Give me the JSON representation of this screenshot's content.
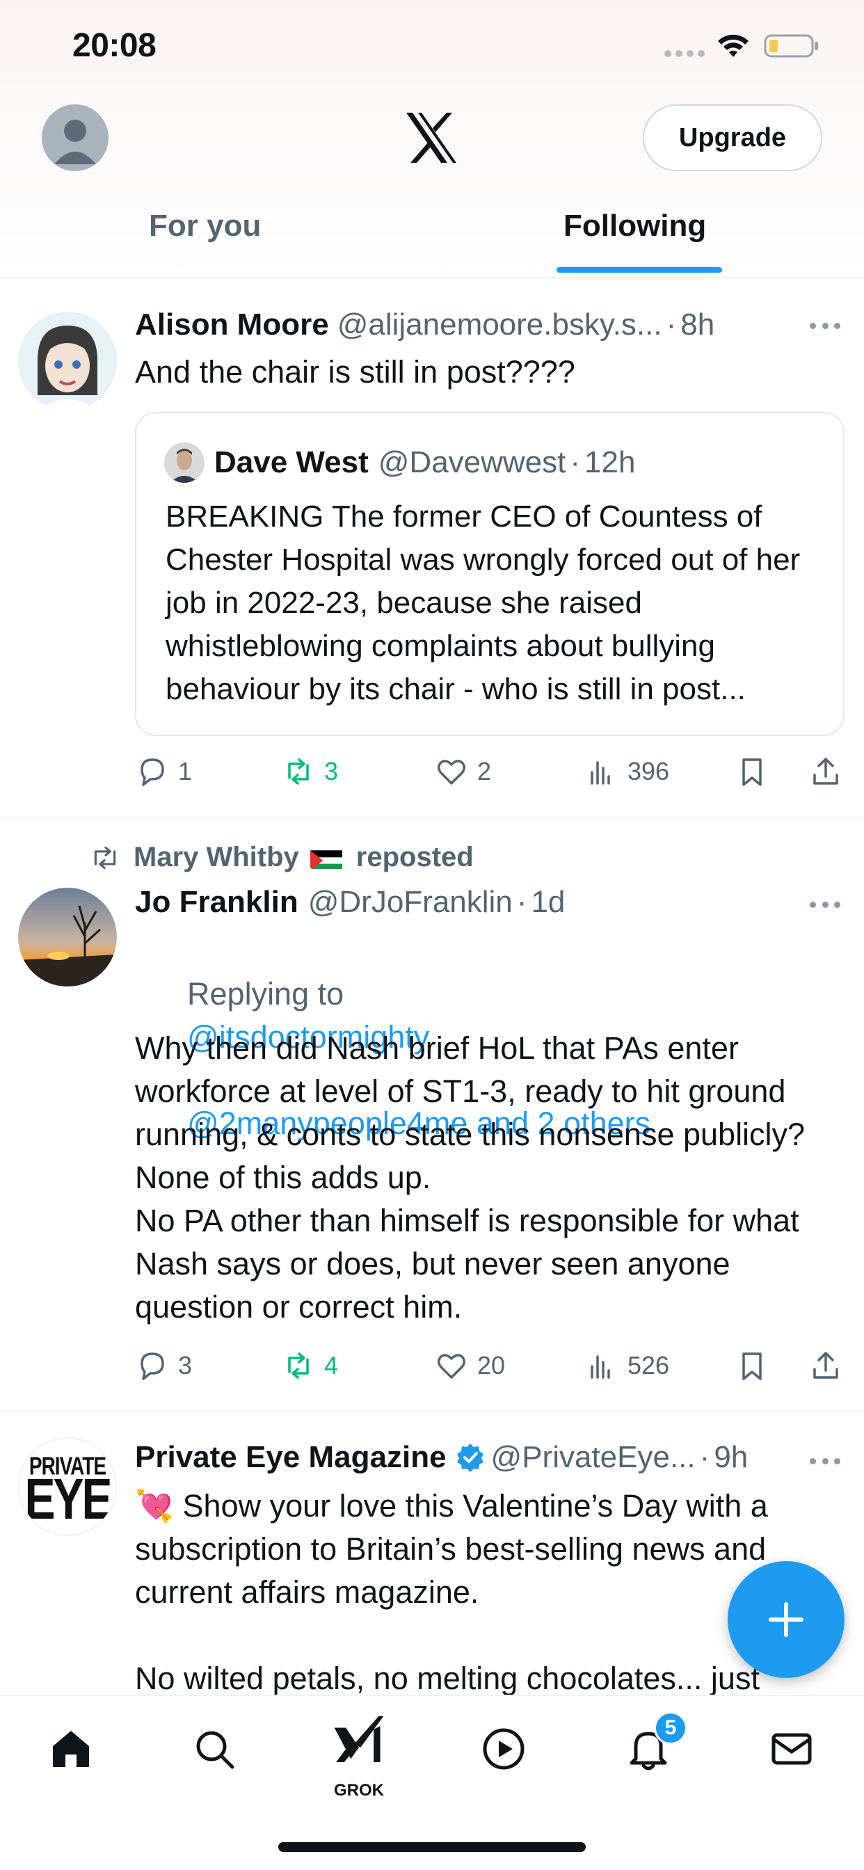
{
  "status_bar": {
    "time": "20:08"
  },
  "header": {
    "logo": "x-logo",
    "upgrade_label": "Upgrade"
  },
  "tabs": [
    {
      "label": "For you",
      "active": false
    },
    {
      "label": "Following",
      "active": true
    }
  ],
  "tweets": [
    {
      "name": "Alison Moore",
      "handle": "@alijanemoore.bsky.s...",
      "time": "8h",
      "text": "And the chair is still in post????",
      "quote": {
        "name": "Dave West",
        "handle": "@Davewwest",
        "time": "12h",
        "text": "BREAKING The former CEO of Countess of Chester Hospital was wrongly forced out of her job in 2022-23, because she raised whistleblowing complaints about bullying behaviour by its chair - who is still in post..."
      },
      "replies": "1",
      "reposts": "3",
      "likes": "2",
      "views": "396"
    },
    {
      "reposted_by": "Mary Whitby",
      "reposted_label": "reposted",
      "name": "Jo Franklin",
      "handle": "@DrJoFranklin",
      "time": "1d",
      "replying_label": "Replying to",
      "replying_to_1": "@itsdoctormighty",
      "replying_to_2": "@2manypeople4me and 2 others",
      "text": "Why then did Nash brief HoL that PAs enter workforce at level of ST1-3, ready to hit ground running, & conts to state this nonsense publicly? None of this adds up.\nNo PA other than himself is responsible for what Nash says or does, but never seen anyone question or correct him.",
      "replies": "3",
      "reposts": "4",
      "likes": "20",
      "views": "526"
    },
    {
      "name": "Private Eye Magazine",
      "handle": "@PrivateEye...",
      "time": "9h",
      "verified": true,
      "avatar_text_1": "PRIVATE",
      "avatar_text_2": "EYE",
      "text": "💘 Show your love this Valentine’s Day with a subscription to Britain’s best-selling news and current affairs magazine.\n\nNo wilted petals, no melting chocolates... just"
    }
  ],
  "bottom_nav": {
    "items": [
      "home-icon",
      "search-icon",
      "grok-icon",
      "video-icon",
      "notifications-icon",
      "messages-icon"
    ],
    "grok_label": "GROK",
    "notification_count": "5"
  },
  "colors": {
    "accent": "#1d9bf0",
    "repost_green": "#00ba7c",
    "muted": "#536471"
  }
}
